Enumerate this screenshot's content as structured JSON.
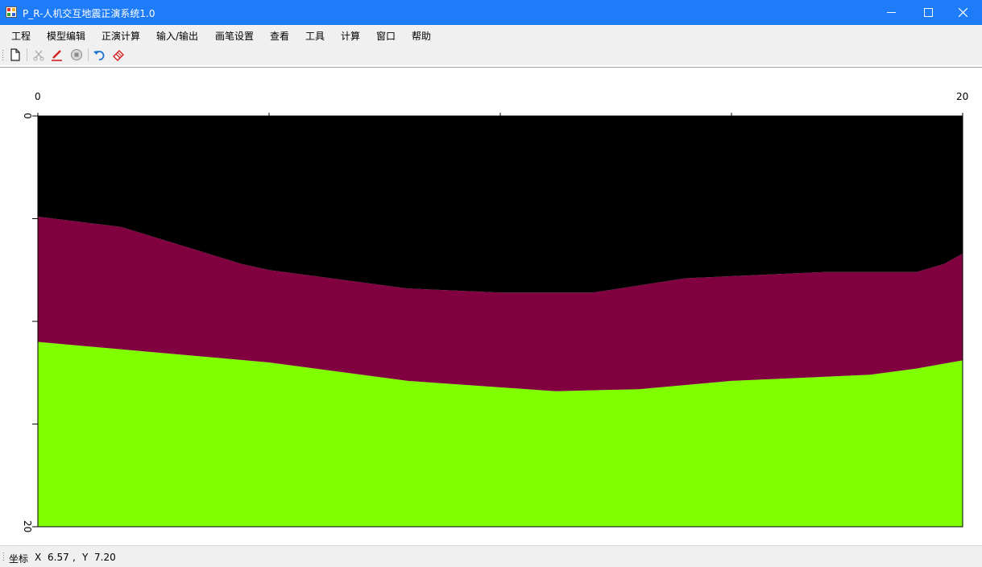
{
  "window": {
    "title": "P_R-人机交互地震正演系统1.0",
    "title_bar_color": "#1f7cf8"
  },
  "menu": {
    "items": [
      "工程",
      "模型编辑",
      "正演计算",
      "输入/输出",
      "画笔设置",
      "查看",
      "工具",
      "计算",
      "窗口",
      "帮助"
    ]
  },
  "toolbar": {
    "buttons": [
      "new-file-icon",
      "cut-icon",
      "pencil-icon",
      "stop-icon",
      "undo-icon",
      "eraser-icon"
    ]
  },
  "plot": {
    "x_ticks": [
      "0",
      "20"
    ],
    "y_ticks": [
      "0",
      "20"
    ],
    "x_range": [
      0,
      20
    ],
    "y_range": [
      0,
      20
    ],
    "layers": [
      {
        "name": "layer-top",
        "color": "#000000"
      },
      {
        "name": "layer-middle",
        "color": "#800040"
      },
      {
        "name": "layer-bottom",
        "color": "#80ff00"
      }
    ],
    "boundary_1": [
      [
        0,
        4.9
      ],
      [
        1.8,
        5.4
      ],
      [
        4.4,
        7.2
      ],
      [
        5.0,
        7.5
      ],
      [
        8.0,
        8.4
      ],
      [
        10.0,
        8.6
      ],
      [
        12.0,
        8.6
      ],
      [
        14.0,
        7.9
      ],
      [
        17.0,
        7.6
      ],
      [
        19.0,
        7.6
      ],
      [
        19.6,
        7.2
      ],
      [
        20,
        6.7
      ]
    ],
    "boundary_2": [
      [
        0,
        11.0
      ],
      [
        2.0,
        11.4
      ],
      [
        5.0,
        12.0
      ],
      [
        8.0,
        12.9
      ],
      [
        11.2,
        13.4
      ],
      [
        13.0,
        13.3
      ],
      [
        15.0,
        12.9
      ],
      [
        18.0,
        12.6
      ],
      [
        19.0,
        12.3
      ],
      [
        20,
        11.9
      ]
    ]
  },
  "status": {
    "label": "坐标",
    "x_label": "X",
    "x_value": "6.57",
    "separator": ",",
    "y_label": "Y",
    "y_value": "7.20"
  }
}
